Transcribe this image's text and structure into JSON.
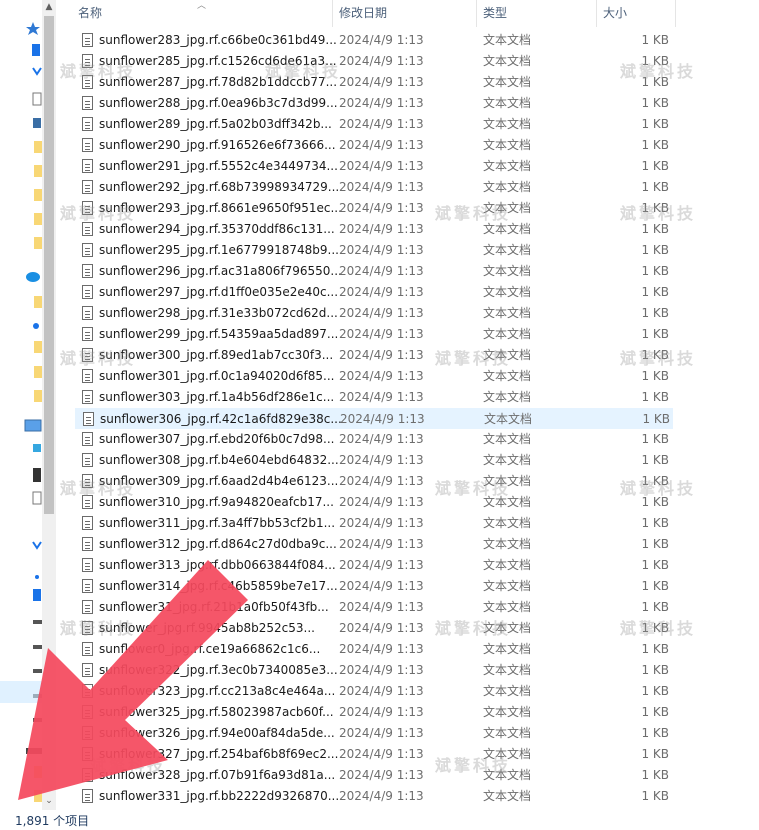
{
  "header": {
    "name_label": "名称",
    "date_label": "修改日期",
    "type_label": "类型",
    "size_label": "大小"
  },
  "files": [
    {
      "name": "sunflower283_jpg.rf.c66be0c361bd49...",
      "date": "2024/4/9 1:13",
      "type": "文本文档",
      "size": "1 KB"
    },
    {
      "name": "sunflower285_jpg.rf.c1526cd6de61a3...",
      "date": "2024/4/9 1:13",
      "type": "文本文档",
      "size": "1 KB"
    },
    {
      "name": "sunflower287_jpg.rf.78d82b1ddccb77...",
      "date": "2024/4/9 1:13",
      "type": "文本文档",
      "size": "1 KB"
    },
    {
      "name": "sunflower288_jpg.rf.0ea96b3c7d3d99...",
      "date": "2024/4/9 1:13",
      "type": "文本文档",
      "size": "1 KB"
    },
    {
      "name": "sunflower289_jpg.rf.5a02b03dff342b...",
      "date": "2024/4/9 1:13",
      "type": "文本文档",
      "size": "1 KB"
    },
    {
      "name": "sunflower290_jpg.rf.916526e6f73666...",
      "date": "2024/4/9 1:13",
      "type": "文本文档",
      "size": "1 KB"
    },
    {
      "name": "sunflower291_jpg.rf.5552c4e3449734...",
      "date": "2024/4/9 1:13",
      "type": "文本文档",
      "size": "1 KB"
    },
    {
      "name": "sunflower292_jpg.rf.68b73998934729...",
      "date": "2024/4/9 1:13",
      "type": "文本文档",
      "size": "1 KB"
    },
    {
      "name": "sunflower293_jpg.rf.8661e9650f951ec...",
      "date": "2024/4/9 1:13",
      "type": "文本文档",
      "size": "1 KB"
    },
    {
      "name": "sunflower294_jpg.rf.35370ddf86c131...",
      "date": "2024/4/9 1:13",
      "type": "文本文档",
      "size": "1 KB"
    },
    {
      "name": "sunflower295_jpg.rf.1e6779918748b9...",
      "date": "2024/4/9 1:13",
      "type": "文本文档",
      "size": "1 KB"
    },
    {
      "name": "sunflower296_jpg.rf.ac31a806f796550...",
      "date": "2024/4/9 1:13",
      "type": "文本文档",
      "size": "1 KB"
    },
    {
      "name": "sunflower297_jpg.rf.d1ff0e035e2e40c...",
      "date": "2024/4/9 1:13",
      "type": "文本文档",
      "size": "1 KB"
    },
    {
      "name": "sunflower298_jpg.rf.31e33b072cd62d...",
      "date": "2024/4/9 1:13",
      "type": "文本文档",
      "size": "1 KB"
    },
    {
      "name": "sunflower299_jpg.rf.54359aa5dad897...",
      "date": "2024/4/9 1:13",
      "type": "文本文档",
      "size": "1 KB"
    },
    {
      "name": "sunflower300_jpg.rf.89ed1ab7cc30f3...",
      "date": "2024/4/9 1:13",
      "type": "文本文档",
      "size": "1 KB"
    },
    {
      "name": "sunflower301_jpg.rf.0c1a94020d6f85...",
      "date": "2024/4/9 1:13",
      "type": "文本文档",
      "size": "1 KB"
    },
    {
      "name": "sunflower303_jpg.rf.1a4b56df286e1c...",
      "date": "2024/4/9 1:13",
      "type": "文本文档",
      "size": "1 KB"
    },
    {
      "name": "sunflower306_jpg.rf.42c1a6fd829e38c...",
      "date": "2024/4/9 1:13",
      "type": "文本文档",
      "size": "1 KB"
    },
    {
      "name": "sunflower307_jpg.rf.ebd20f6b0c7d98...",
      "date": "2024/4/9 1:13",
      "type": "文本文档",
      "size": "1 KB"
    },
    {
      "name": "sunflower308_jpg.rf.b4e604ebd64832...",
      "date": "2024/4/9 1:13",
      "type": "文本文档",
      "size": "1 KB"
    },
    {
      "name": "sunflower309_jpg.rf.6aad2d4b4e6123...",
      "date": "2024/4/9 1:13",
      "type": "文本文档",
      "size": "1 KB"
    },
    {
      "name": "sunflower310_jpg.rf.9a94820eafcb17...",
      "date": "2024/4/9 1:13",
      "type": "文本文档",
      "size": "1 KB"
    },
    {
      "name": "sunflower311_jpg.rf.3a4ff7bb53cf2b1...",
      "date": "2024/4/9 1:13",
      "type": "文本文档",
      "size": "1 KB"
    },
    {
      "name": "sunflower312_jpg.rf.d864c27d0dba9c...",
      "date": "2024/4/9 1:13",
      "type": "文本文档",
      "size": "1 KB"
    },
    {
      "name": "sunflower313_jpg.rf.dbb0663844f084...",
      "date": "2024/4/9 1:13",
      "type": "文本文档",
      "size": "1 KB"
    },
    {
      "name": "sunflower314_jpg.rf.c46b5859be7e17...",
      "date": "2024/4/9 1:13",
      "type": "文本文档",
      "size": "1 KB"
    },
    {
      "name": "sunflower31_jpg.rf.21b1a0fb50f43fb...",
      "date": "2024/4/9 1:13",
      "type": "文本文档",
      "size": "1 KB"
    },
    {
      "name": "sunflower_jpg.rf.9945ab8b252c53...",
      "date": "2024/4/9 1:13",
      "type": "文本文档",
      "size": "1 KB"
    },
    {
      "name": "sunflower0_jpg.rf.ce19a66862c1c6...",
      "date": "2024/4/9 1:13",
      "type": "文本文档",
      "size": "1 KB"
    },
    {
      "name": "sunflower322_jpg.rf.3ec0b7340085e3...",
      "date": "2024/4/9 1:13",
      "type": "文本文档",
      "size": "1 KB"
    },
    {
      "name": "sunflower323_jpg.rf.cc213a8c4e464a...",
      "date": "2024/4/9 1:13",
      "type": "文本文档",
      "size": "1 KB"
    },
    {
      "name": "sunflower325_jpg.rf.58023987acb60f...",
      "date": "2024/4/9 1:13",
      "type": "文本文档",
      "size": "1 KB"
    },
    {
      "name": "sunflower326_jpg.rf.94e00af84da5de...",
      "date": "2024/4/9 1:13",
      "type": "文本文档",
      "size": "1 KB"
    },
    {
      "name": "sunflower327_jpg.rf.254baf6b8f69ec2...",
      "date": "2024/4/9 1:13",
      "type": "文本文档",
      "size": "1 KB"
    },
    {
      "name": "sunflower328_jpg.rf.07b91f6a93d81a...",
      "date": "2024/4/9 1:13",
      "type": "文本文档",
      "size": "1 KB"
    },
    {
      "name": "sunflower331_jpg.rf.bb2222d9326870...",
      "date": "2024/4/9 1:13",
      "type": "文本文档",
      "size": "1 KB"
    }
  ],
  "selected_index": 18,
  "watermark": "斌擎科技",
  "status": {
    "item_count": "1,891 个项目"
  },
  "colors": {
    "selection": "#e5f3ff",
    "arrow": "#f4495e",
    "nav_blue": "#1a73e8",
    "folder_yellow": "#f8d775"
  },
  "icons": [
    "file-text-icon",
    "sort-up-icon",
    "scroll-up-icon",
    "scroll-down-icon",
    "red-arrow-annotation"
  ]
}
